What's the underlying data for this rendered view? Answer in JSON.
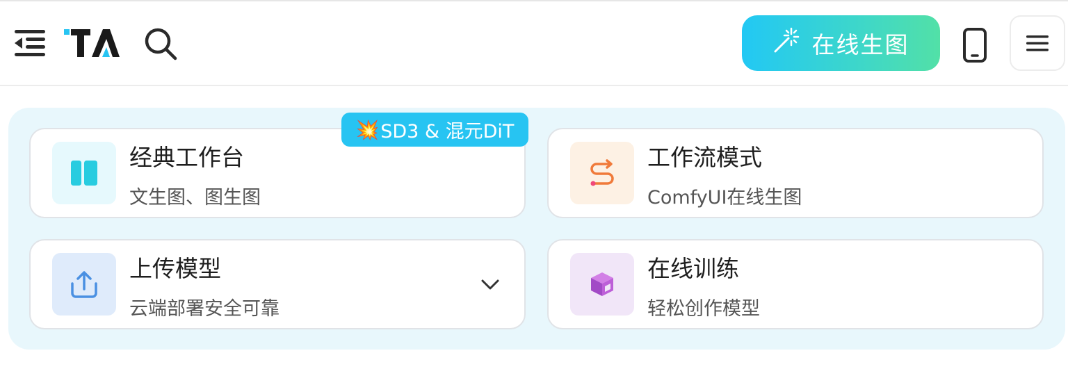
{
  "header": {
    "logo_text": "TA",
    "cta_label": "在线生图",
    "icons": {
      "collapse": "menu-collapse-icon",
      "search": "search-icon",
      "cta": "magic-wand-icon",
      "mobile": "phone-icon",
      "menu": "hamburger-menu-icon"
    }
  },
  "badge": {
    "emoji": "💥",
    "label": "SD3 & 混元DiT"
  },
  "cards": [
    {
      "title": "经典工作台",
      "subtitle": "文生图、图生图",
      "icon": "workbench-icon"
    },
    {
      "title": "工作流模式",
      "subtitle": "ComfyUI在线生图",
      "icon": "workflow-icon"
    },
    {
      "title": "上传模型",
      "subtitle": "云端部署安全可靠",
      "icon": "upload-icon"
    },
    {
      "title": "在线训练",
      "subtitle": "轻松创作模型",
      "icon": "cube-icon"
    }
  ],
  "colors": {
    "cta_gradient_start": "#22c8f4",
    "cta_gradient_end": "#52e0a7",
    "badge": "#27c4f2",
    "panel_bg": "#e8f7fc",
    "workbench_icon": "#28cce0",
    "workflow_icon": "#f07a3a",
    "upload_icon": "#4a90e2",
    "cube_icon": "#b45ad0"
  }
}
